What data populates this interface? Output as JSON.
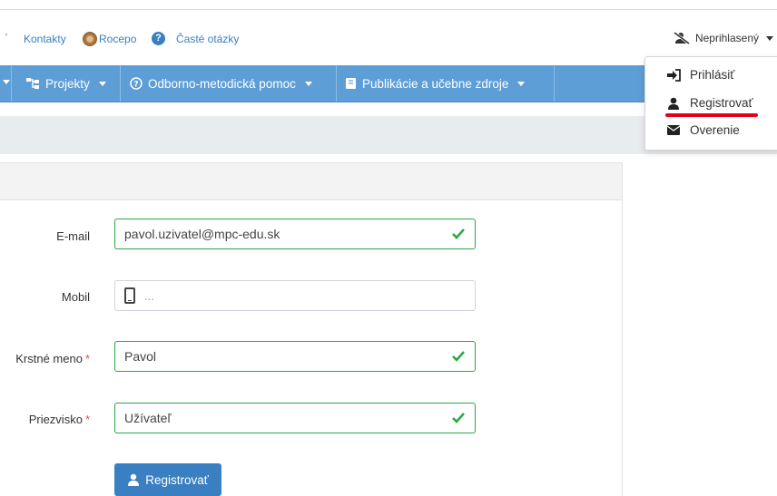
{
  "topbar": {
    "links": [
      "Kontakty",
      "Rocepo",
      "Časté otázky"
    ],
    "user_status": "Neprihlasený"
  },
  "navbar": {
    "items": [
      {
        "label": "Projekty",
        "icon": "sitemap-icon"
      },
      {
        "label": "Odborno-metodická pomoc",
        "icon": "question-circle-icon"
      },
      {
        "label": "Publikácie a učebne zdroje",
        "icon": "book-icon"
      }
    ]
  },
  "dropdown": {
    "items": [
      {
        "label": "Prihlásiť",
        "icon": "sign-in-icon"
      },
      {
        "label": "Registrovať",
        "icon": "user-icon"
      },
      {
        "label": "Overenie",
        "icon": "envelope-icon"
      }
    ]
  },
  "form": {
    "email": {
      "label": "E-mail",
      "value": "pavol.uzivatel@mpc-edu.sk"
    },
    "mobile": {
      "label": "Mobil",
      "placeholder": "..."
    },
    "first_name": {
      "label": "Krstné meno",
      "value": "Pavol",
      "required_mark": "*"
    },
    "last_name": {
      "label": "Priezvisko",
      "value": "Užívateľ",
      "required_mark": "*"
    },
    "submit_label": "Registrovať"
  },
  "colors": {
    "navbar": "#5e9ed6",
    "primary": "#3a7fc1",
    "valid": "#28a745",
    "highlight": "#e3001b"
  }
}
